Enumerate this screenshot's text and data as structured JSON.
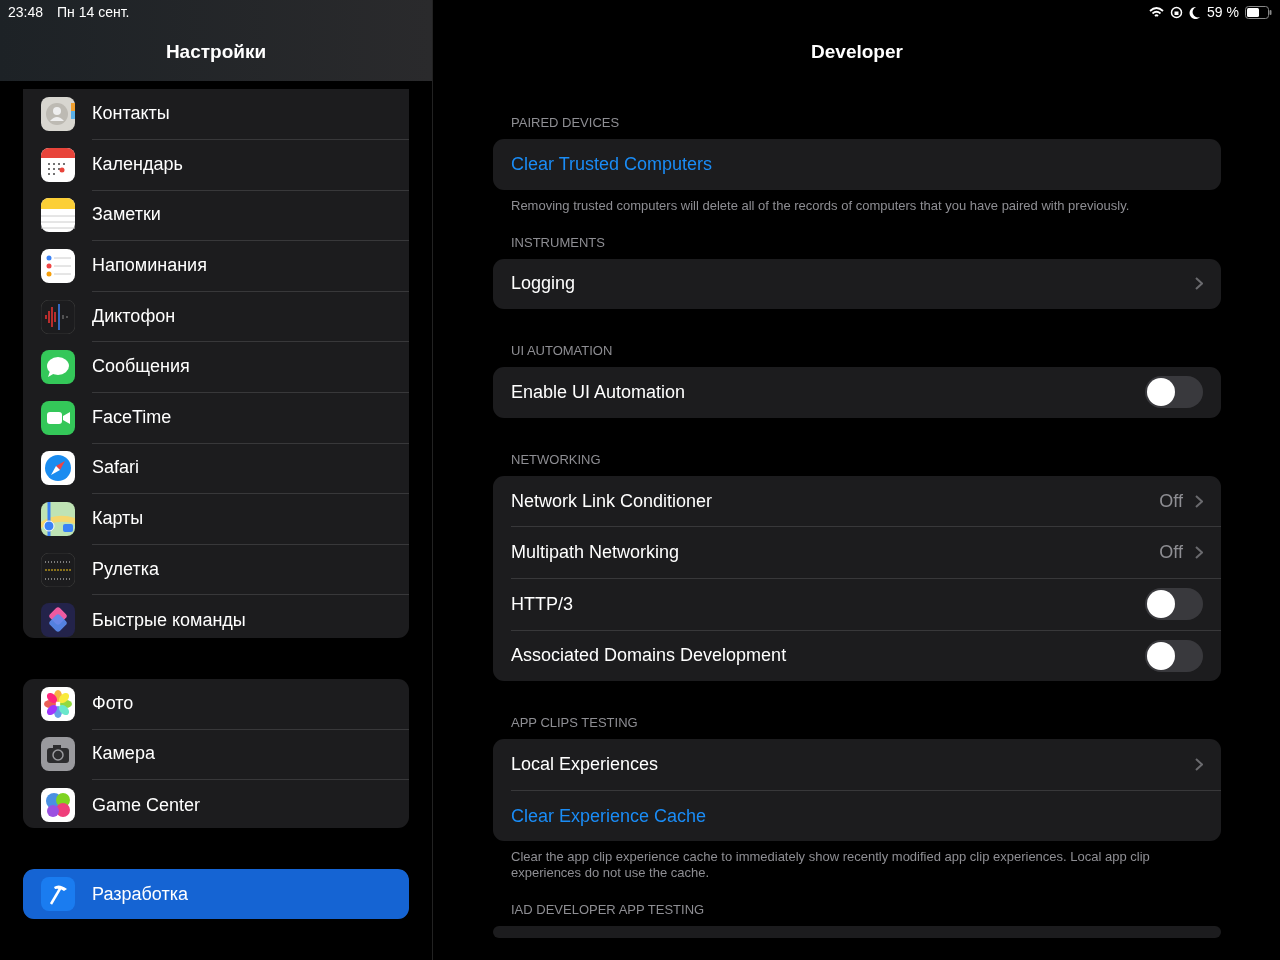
{
  "status_bar": {
    "time": "23:48",
    "date": "Пн 14 сент.",
    "battery": "59 %"
  },
  "sidebar": {
    "title": "Настройки",
    "groups": [
      {
        "items": [
          {
            "label": "Контакты",
            "kind": "contacts",
            "selected": false
          },
          {
            "label": "Календарь",
            "kind": "calendar",
            "selected": false
          },
          {
            "label": "Заметки",
            "kind": "notes",
            "selected": false
          },
          {
            "label": "Напоминания",
            "kind": "reminders",
            "selected": false
          },
          {
            "label": "Диктофон",
            "kind": "voice",
            "selected": false
          },
          {
            "label": "Сообщения",
            "kind": "messages",
            "selected": false
          },
          {
            "label": "FaceTime",
            "kind": "facetime",
            "selected": false
          },
          {
            "label": "Safari",
            "kind": "safari",
            "selected": false
          },
          {
            "label": "Карты",
            "kind": "maps",
            "selected": false
          },
          {
            "label": "Рулетка",
            "kind": "measure",
            "selected": false
          },
          {
            "label": "Быстрые команды",
            "kind": "shortcuts",
            "selected": false
          }
        ]
      },
      {
        "items": [
          {
            "label": "Фото",
            "kind": "photos",
            "selected": false
          },
          {
            "label": "Камера",
            "kind": "camera",
            "selected": false
          },
          {
            "label": "Game Center",
            "kind": "gamecenter",
            "selected": false
          }
        ]
      },
      {
        "items": [
          {
            "label": "Разработка",
            "kind": "developer",
            "selected": true
          }
        ]
      }
    ]
  },
  "detail": {
    "title": "Developer",
    "sections": [
      {
        "header": "PAIRED DEVICES",
        "rows": [
          {
            "kind": "action",
            "label": "Clear Trusted Computers"
          }
        ],
        "footer": "Removing trusted computers will delete all of the records of computers that you have paired with previously."
      },
      {
        "header": "INSTRUMENTS",
        "rows": [
          {
            "kind": "link",
            "label": "Logging"
          }
        ]
      },
      {
        "header": "UI AUTOMATION",
        "rows": [
          {
            "kind": "toggle",
            "label": "Enable UI Automation",
            "on": false
          }
        ]
      },
      {
        "header": "NETWORKING",
        "rows": [
          {
            "kind": "link",
            "label": "Network Link Conditioner",
            "value": "Off"
          },
          {
            "kind": "link",
            "label": "Multipath Networking",
            "value": "Off"
          },
          {
            "kind": "toggle",
            "label": "HTTP/3",
            "on": false
          },
          {
            "kind": "toggle",
            "label": "Associated Domains Development",
            "on": false
          }
        ]
      },
      {
        "header": "APP CLIPS TESTING",
        "rows": [
          {
            "kind": "link",
            "label": "Local Experiences"
          },
          {
            "kind": "action",
            "label": "Clear Experience Cache"
          }
        ],
        "footer": "Clear the app clip experience cache to immediately show recently modified app clip experiences. Local app clip experiences do not use the cache."
      },
      {
        "header": "IAD DEVELOPER APP TESTING"
      }
    ]
  }
}
